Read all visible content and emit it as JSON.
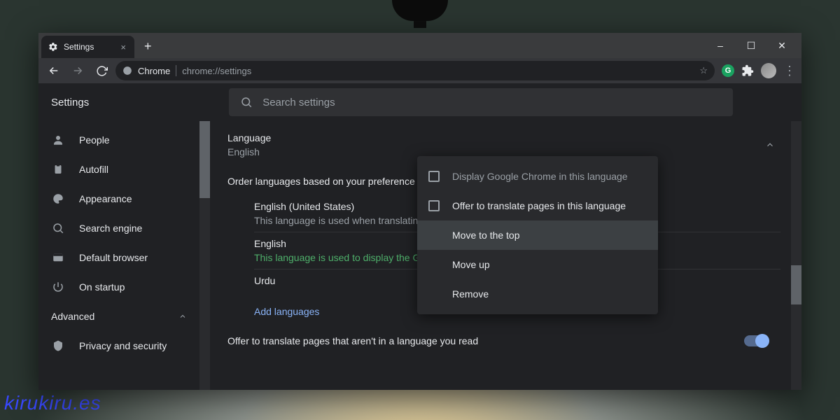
{
  "watermark": "kirukiru.es",
  "tab": {
    "title": "Settings",
    "close": "×",
    "newtab": "+"
  },
  "wincontrols": {
    "min": "–",
    "max": "☐",
    "close": "✕"
  },
  "toolbar": {
    "back": "←",
    "forward": "→",
    "reload": "⟳",
    "chip": "Chrome",
    "url": "chrome://settings",
    "star": "☆"
  },
  "header": {
    "title": "Settings",
    "search_placeholder": "Search settings"
  },
  "sidebar": {
    "items": [
      {
        "label": "People"
      },
      {
        "label": "Autofill"
      },
      {
        "label": "Appearance"
      },
      {
        "label": "Search engine"
      },
      {
        "label": "Default browser"
      },
      {
        "label": "On startup"
      }
    ],
    "advanced": "Advanced",
    "privacy": "Privacy and security"
  },
  "languages": {
    "section": "Language",
    "current": "English",
    "order_label": "Order languages based on your preference",
    "list": [
      {
        "name": "English (United States)",
        "sub": "This language is used when translating pages",
        "sub_style": ""
      },
      {
        "name": "English",
        "sub": "This language is used to display the Google Chrome UI",
        "sub_style": "green"
      },
      {
        "name": "Urdu",
        "sub": "",
        "sub_style": ""
      }
    ],
    "add": "Add languages",
    "translate_row": "Offer to translate pages that aren't in a language you read"
  },
  "menu": {
    "items": [
      {
        "label": "Display Google Chrome in this language",
        "checkbox": true,
        "dim": true
      },
      {
        "label": "Offer to translate pages in this language",
        "checkbox": true,
        "dim": false
      },
      {
        "label": "Move to the top",
        "checkbox": false,
        "active": true
      },
      {
        "label": "Move up",
        "checkbox": false
      },
      {
        "label": "Remove",
        "checkbox": false
      }
    ]
  }
}
